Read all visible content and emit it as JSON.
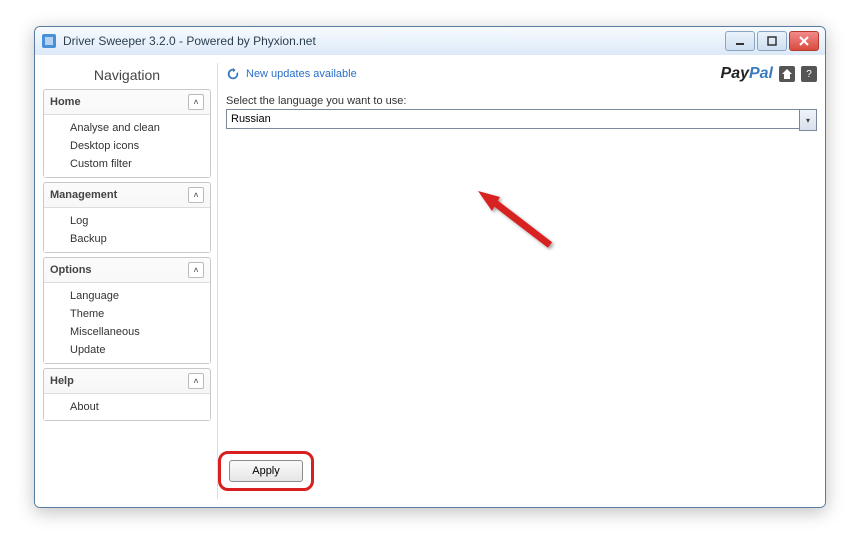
{
  "window": {
    "title": "Driver Sweeper 3.2.0 - Powered by Phyxion.net"
  },
  "nav": {
    "title": "Navigation",
    "groups": [
      {
        "header": "Home",
        "items": [
          "Analyse and clean",
          "Desktop icons",
          "Custom filter"
        ]
      },
      {
        "header": "Management",
        "items": [
          "Log",
          "Backup"
        ]
      },
      {
        "header": "Options",
        "items": [
          "Language",
          "Theme",
          "Miscellaneous",
          "Update"
        ]
      },
      {
        "header": "Help",
        "items": [
          "About"
        ]
      }
    ]
  },
  "main": {
    "update_link": "New updates available",
    "paypal": "PayPal",
    "language_label": "Select the language you want to use:",
    "language_value": "Russian",
    "apply": "Apply"
  }
}
